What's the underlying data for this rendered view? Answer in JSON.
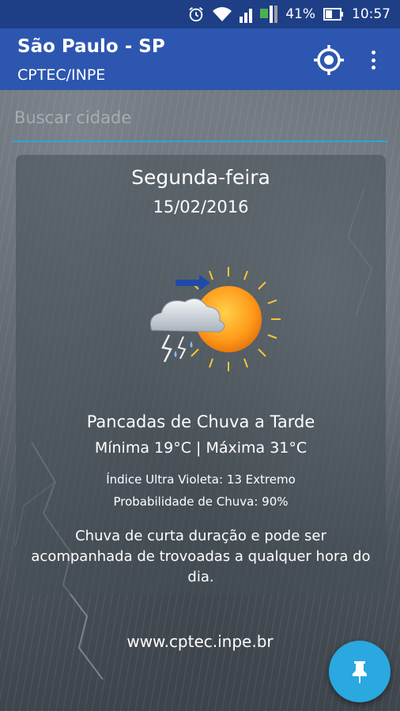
{
  "status_bar": {
    "battery": "41%",
    "time": "10:57",
    "icons": [
      "alarm-icon",
      "wifi-icon",
      "signal-icon",
      "battery-icon"
    ]
  },
  "app_bar": {
    "title": "São Paulo - SP",
    "subtitle": "CPTEC/INPE",
    "icons": [
      "my-location-icon",
      "more-vert-icon"
    ]
  },
  "search": {
    "placeholder": "Buscar cidade",
    "value": ""
  },
  "forecast": {
    "day": "Segunda-feira",
    "date": "15/02/2016",
    "icon": "sun-cloud-thunderstorm-icon",
    "condition": "Pancadas de Chuva a Tarde",
    "temps": "Mínima 19°C  |  Máxima 31°C",
    "uv": "Índice Ultra Violeta: 13 Extremo",
    "rain_probability": "Probabilidade de Chuva: 90%",
    "description": "Chuva de curta duração e pode ser acompanhada de trovoadas a qualquer hora do dia."
  },
  "footer": {
    "website": "www.cptec.inpe.br"
  },
  "fab": {
    "icon": "pin-icon"
  },
  "colors": {
    "status_bar": "#1e3f86",
    "app_bar": "#2d56b0",
    "accent": "#2aa8e0"
  }
}
